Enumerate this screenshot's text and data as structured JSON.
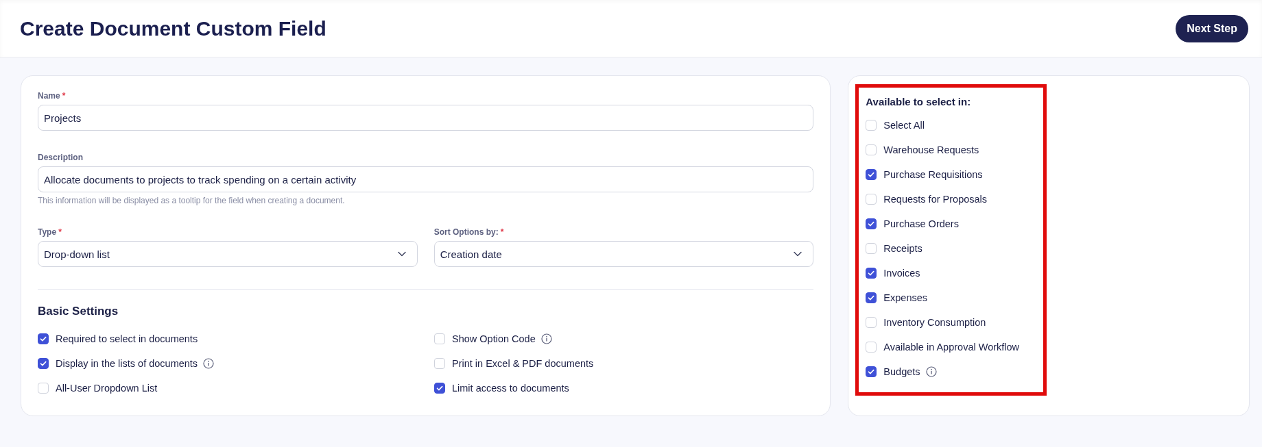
{
  "header": {
    "title": "Create Document Custom Field",
    "next_button": "Next Step"
  },
  "fields": [
    {
      "kind": "input",
      "label": "Name",
      "required_mark": "*",
      "value": "Projects"
    },
    {
      "kind": "input",
      "label": "Description",
      "value": "Allocate documents to projects to track spending on a certain activity",
      "hint": "This information will be displayed as a tooltip for the field when creating a document."
    }
  ],
  "selects": [
    {
      "label": "Type",
      "required_mark": "*",
      "value": "Drop-down list"
    },
    {
      "label": "Sort Options by:",
      "required_mark": "*",
      "value": "Creation date"
    }
  ],
  "basic_settings": {
    "title": "Basic Settings",
    "items": [
      {
        "label": "Required to select in documents",
        "checked": true,
        "info": false
      },
      {
        "label": "Show Option Code",
        "checked": false,
        "info": true
      },
      {
        "label": "Display in the lists of documents",
        "checked": true,
        "info": true
      },
      {
        "label": "Print in Excel & PDF documents",
        "checked": false,
        "info": false
      },
      {
        "label": "All-User Dropdown List",
        "checked": false,
        "info": false
      },
      {
        "label": "Limit access to documents",
        "checked": true,
        "info": false
      }
    ]
  },
  "available": {
    "title": "Available to select in:",
    "items": [
      {
        "label": "Select All",
        "checked": false,
        "info": false
      },
      {
        "label": "Warehouse Requests",
        "checked": false,
        "info": false
      },
      {
        "label": "Purchase Requisitions",
        "checked": true,
        "info": false
      },
      {
        "label": "Requests for Proposals",
        "checked": false,
        "info": false
      },
      {
        "label": "Purchase Orders",
        "checked": true,
        "info": false
      },
      {
        "label": "Receipts",
        "checked": false,
        "info": false
      },
      {
        "label": "Invoices",
        "checked": true,
        "info": false
      },
      {
        "label": "Expenses",
        "checked": true,
        "info": false
      },
      {
        "label": "Inventory Consumption",
        "checked": false,
        "info": false
      },
      {
        "label": "Available in Approval Workflow",
        "checked": false,
        "info": false
      },
      {
        "label": "Budgets",
        "checked": true,
        "info": true
      }
    ]
  }
}
